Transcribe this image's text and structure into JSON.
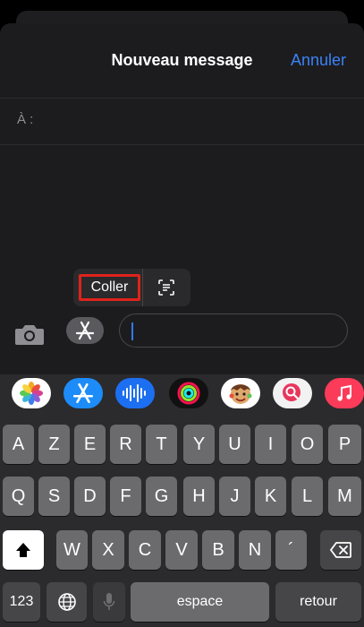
{
  "nav": {
    "title": "Nouveau message",
    "cancel": "Annuler"
  },
  "recipient": {
    "label": "À :"
  },
  "popup": {
    "paste": "Coller"
  },
  "app_strip": [
    "photos-icon",
    "app-store-icon",
    "audio-message-icon",
    "fitness-icon",
    "memoji-icon",
    "search-images-icon",
    "music-icon"
  ],
  "keyboard": {
    "row1": [
      "A",
      "Z",
      "E",
      "R",
      "T",
      "Y",
      "U",
      "I",
      "O",
      "P"
    ],
    "row2": [
      "Q",
      "S",
      "D",
      "F",
      "G",
      "H",
      "J",
      "K",
      "L",
      "M"
    ],
    "row3": [
      "W",
      "X",
      "C",
      "V",
      "B",
      "N",
      "´"
    ],
    "numbers": "123",
    "space": "espace",
    "return": "retour"
  }
}
